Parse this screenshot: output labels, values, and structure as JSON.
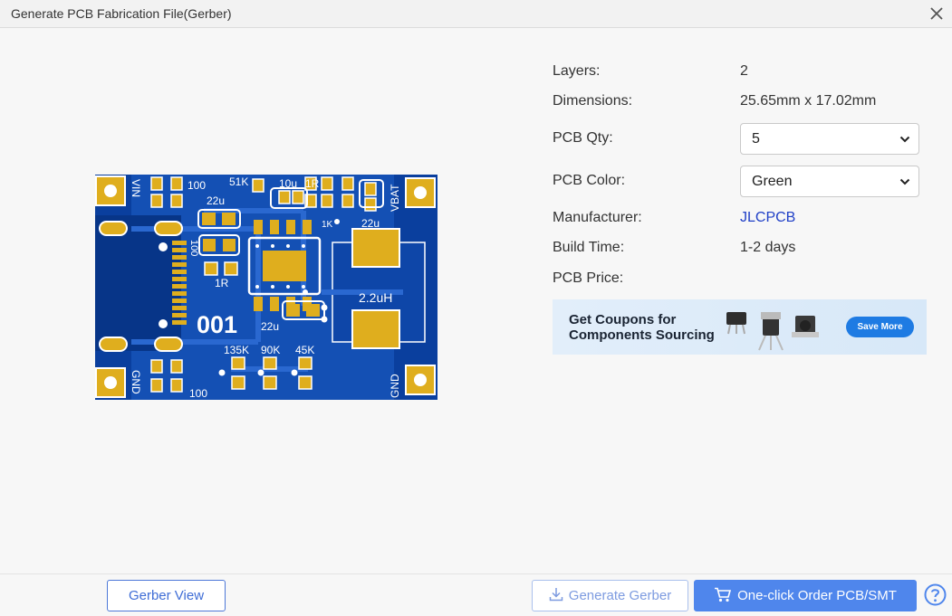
{
  "window": {
    "title": "Generate PCB Fabrication File(Gerber)"
  },
  "pcb_preview": {
    "silkscreen": {
      "vin": "VIN",
      "gnd_left": "GND",
      "vbat": "VBAT",
      "gnd_right": "GND",
      "r100_top": "100",
      "r51k": "51K",
      "c10u": "10u",
      "r1r_top": "1R",
      "c22u_left": "22u",
      "r1k": "1K",
      "c22u_right": "22u",
      "r100_side": "100",
      "r1r_mid": "1R",
      "inductor": "2.2uH",
      "board_id": "001",
      "c22u_bottom": "22u",
      "r135k": "135K",
      "r90k": "90K",
      "r45k": "45K",
      "r100_bottom": "100"
    }
  },
  "specs": {
    "layers": {
      "label": "Layers:",
      "value": "2"
    },
    "dimensions": {
      "label": "Dimensions:",
      "value": "25.65mm x 17.02mm"
    },
    "qty": {
      "label": "PCB Qty:",
      "value": "5"
    },
    "color": {
      "label": "PCB Color:",
      "value": "Green"
    },
    "manufacturer": {
      "label": "Manufacturer:",
      "value": "JLCPCB"
    },
    "build_time": {
      "label": "Build Time:",
      "value": "1-2 days"
    },
    "price": {
      "label": "PCB Price:"
    }
  },
  "banner": {
    "line1": "Get Coupons for",
    "line2": "Components Sourcing",
    "button": "Save More"
  },
  "footer": {
    "gerber_view": "Gerber View",
    "generate_gerber": "Generate Gerber",
    "order": "One-click Order PCB/SMT"
  },
  "colors": {
    "board_blue": "#0a3f9e",
    "pad_gold": "#dfae1e",
    "accent": "#4f86ec",
    "link": "#1f3fc7"
  },
  "icons": {
    "close": "close-icon",
    "select_arrow": "chevron-down-icon",
    "download": "download-icon",
    "cart": "cart-icon",
    "help": "help-icon"
  }
}
